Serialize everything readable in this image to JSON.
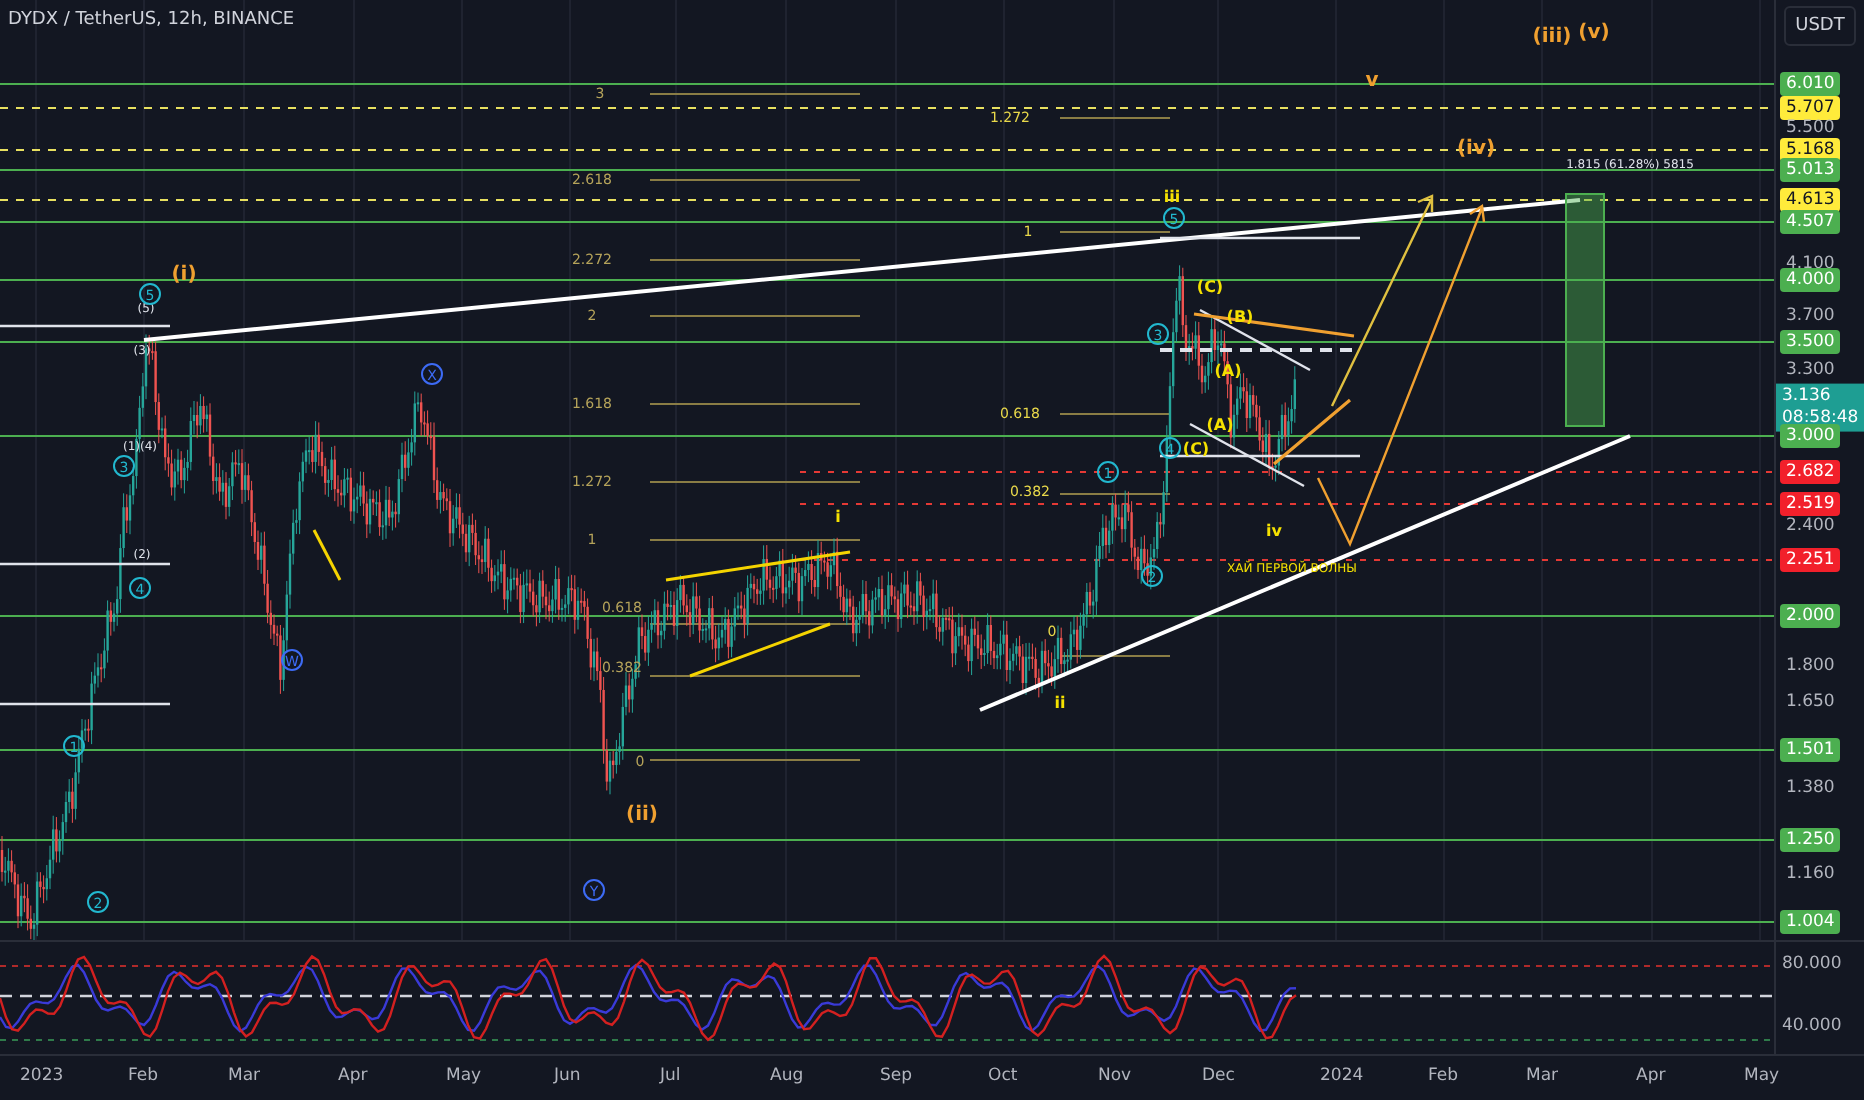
{
  "legend": {
    "symbol": "DYDX / TetherUS, 12h, BINANCE"
  },
  "currency_button": "USDT",
  "price_axis": [
    {
      "label": "6.010",
      "kind": "green"
    },
    {
      "label": "5.707",
      "kind": "yellow"
    },
    {
      "label": "5.500",
      "kind": "plain"
    },
    {
      "label": "5.168",
      "kind": "yellow"
    },
    {
      "label": "5.013",
      "kind": "green"
    },
    {
      "label": "4.613",
      "kind": "yellow"
    },
    {
      "label": "4.507",
      "kind": "green"
    },
    {
      "label": "4.100",
      "kind": "plain"
    },
    {
      "label": "4.000",
      "kind": "green"
    },
    {
      "label": "3.700",
      "kind": "plain"
    },
    {
      "label": "3.500",
      "kind": "green"
    },
    {
      "label": "3.300",
      "kind": "plain"
    },
    {
      "label": "3.136",
      "kind": "current",
      "countdown": "08:58:48"
    },
    {
      "label": "3.000",
      "kind": "green"
    },
    {
      "label": "2.682",
      "kind": "red"
    },
    {
      "label": "2.519",
      "kind": "red"
    },
    {
      "label": "2.400",
      "kind": "plain"
    },
    {
      "label": "2.251",
      "kind": "red"
    },
    {
      "label": "2.000",
      "kind": "green"
    },
    {
      "label": "1.800",
      "kind": "plain"
    },
    {
      "label": "1.650",
      "kind": "plain"
    },
    {
      "label": "1.501",
      "kind": "green"
    },
    {
      "label": "1.380",
      "kind": "plain"
    },
    {
      "label": "1.250",
      "kind": "green"
    },
    {
      "label": "1.160",
      "kind": "plain"
    },
    {
      "label": "1.004",
      "kind": "green"
    }
  ],
  "oscillator_axis": [
    "80.000",
    "40.000"
  ],
  "time_axis": [
    "2023",
    "Feb",
    "Mar",
    "Apr",
    "May",
    "Jun",
    "Jul",
    "Aug",
    "Sep",
    "Oct",
    "Nov",
    "Dec",
    "2024",
    "Feb",
    "Mar",
    "Apr",
    "May"
  ],
  "annotations": [
    {
      "text": "3",
      "kind": "fib"
    },
    {
      "text": "2.618",
      "kind": "fib"
    },
    {
      "text": "2.272",
      "kind": "fib"
    },
    {
      "text": "2",
      "kind": "fib"
    },
    {
      "text": "1.618",
      "kind": "fib"
    },
    {
      "text": "1.272",
      "kind": "fib"
    },
    {
      "text": "1",
      "kind": "fib"
    },
    {
      "text": "0.618",
      "kind": "fib"
    },
    {
      "text": "0.382",
      "kind": "fib"
    },
    {
      "text": "0",
      "kind": "fib"
    },
    {
      "text": "1.272",
      "kind": "fib-bright"
    },
    {
      "text": "1",
      "kind": "fib-bright"
    },
    {
      "text": "0.618",
      "kind": "fib-bright"
    },
    {
      "text": "0.382",
      "kind": "fib-bright"
    },
    {
      "text": "0",
      "kind": "fib-bright"
    },
    {
      "text": "(i)",
      "kind": "orange"
    },
    {
      "text": "(ii)",
      "kind": "orange"
    },
    {
      "text": "(iii)",
      "kind": "orange"
    },
    {
      "text": "(v)",
      "kind": "orange"
    },
    {
      "text": "(iv)",
      "kind": "orange"
    },
    {
      "text": "v",
      "kind": "orange"
    },
    {
      "text": "i",
      "kind": "yellow"
    },
    {
      "text": "ii",
      "kind": "yellow"
    },
    {
      "text": "iii",
      "kind": "yellow"
    },
    {
      "text": "iv",
      "kind": "yellow"
    },
    {
      "text": "ХАЙ ПЕРВОЙ ВОЛНЫ",
      "kind": "note"
    },
    {
      "text": "1.815 (61.28%) 5815",
      "kind": "white"
    },
    {
      "text": "(5)",
      "kind": "white"
    },
    {
      "text": "(3)",
      "kind": "white"
    },
    {
      "text": "(1)(4)",
      "kind": "white"
    },
    {
      "text": "(2)",
      "kind": "white"
    },
    {
      "text": "(C)",
      "kind": "yellow"
    },
    {
      "text": "(B)",
      "kind": "yellow"
    },
    {
      "text": "(A)",
      "kind": "yellow"
    },
    {
      "text": "(A)",
      "kind": "yellow"
    },
    {
      "text": "(C)",
      "kind": "yellow"
    },
    {
      "text": "5",
      "kind": "cyan"
    },
    {
      "text": "3",
      "kind": "cyan"
    },
    {
      "text": "4",
      "kind": "cyan"
    },
    {
      "text": "1",
      "kind": "cyan"
    },
    {
      "text": "2",
      "kind": "cyan"
    },
    {
      "text": "X",
      "kind": "blue"
    },
    {
      "text": "W",
      "kind": "blue"
    },
    {
      "text": "Y",
      "kind": "blue"
    },
    {
      "text": "5",
      "kind": "cyan"
    },
    {
      "text": "3",
      "kind": "cyan"
    },
    {
      "text": "4",
      "kind": "cyan"
    },
    {
      "text": "1",
      "kind": "cyan"
    },
    {
      "text": "2",
      "kind": "cyan"
    }
  ]
}
